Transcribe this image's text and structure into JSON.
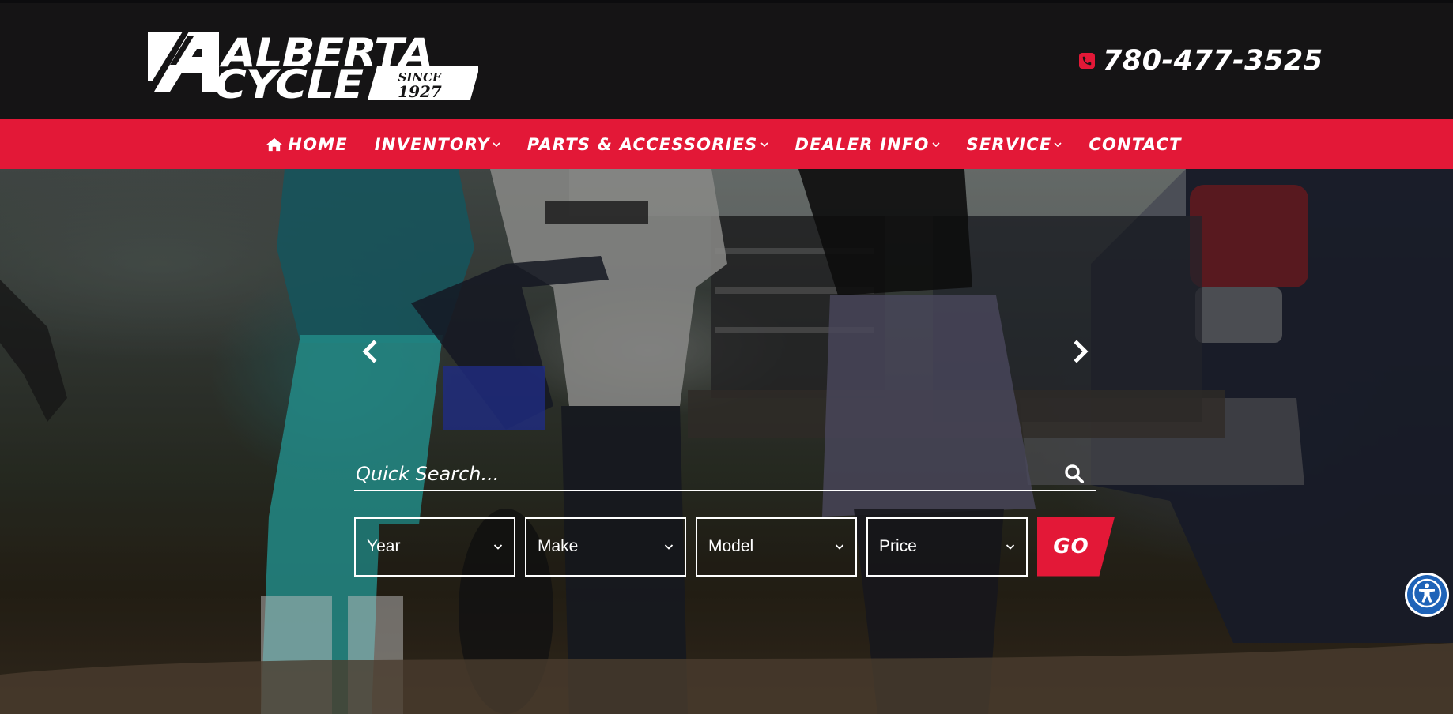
{
  "brand": {
    "logo_line1": "ALBERTA",
    "logo_line2": "CYCLE",
    "logo_since": "SINCE",
    "logo_year": "1927"
  },
  "header": {
    "phone": "780-477-3525",
    "phone_icon": "phone-icon"
  },
  "nav": {
    "items": [
      {
        "label": "HOME",
        "icon": "home-icon",
        "has_dropdown": false
      },
      {
        "label": "INVENTORY",
        "has_dropdown": true
      },
      {
        "label": "PARTS & ACCESSORIES",
        "has_dropdown": true
      },
      {
        "label": "DEALER INFO",
        "has_dropdown": true
      },
      {
        "label": "SERVICE",
        "has_dropdown": true
      },
      {
        "label": "CONTACT",
        "has_dropdown": false
      }
    ]
  },
  "hero": {
    "prev_icon": "chevron-left-icon",
    "next_icon": "chevron-right-icon"
  },
  "search": {
    "placeholder": "Quick Search...",
    "value": ""
  },
  "filters": {
    "year": "Year",
    "make": "Make",
    "model": "Model",
    "price": "Price",
    "go_label": "GO"
  },
  "colors": {
    "accent": "#e31837",
    "header_bg": "#151415",
    "accessibility": "#1e63b8"
  }
}
